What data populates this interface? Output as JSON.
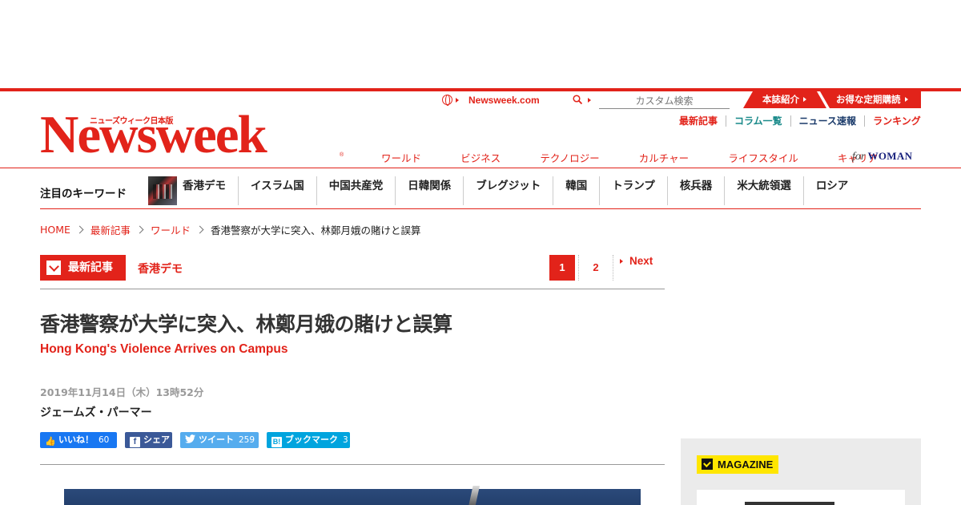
{
  "header": {
    "site_link": "Newsweek.com",
    "search_placeholder": "カスタム検索",
    "tab_about": "本誌紹介",
    "tab_subscribe": "お得な定期購読",
    "sub_links": [
      "最新記事",
      "コラム一覧",
      "ニュース速報",
      "ランキング"
    ],
    "sub_link_colors": [
      "#e2231a",
      "#1a8a8a",
      "#1a3a6a",
      "#e2231a"
    ],
    "logo": "Newsweek",
    "logo_sub": "ニューズウィーク日本版",
    "logo_reg": "®",
    "categories": [
      "ワールド",
      "ビジネス",
      "テクノロジー",
      "カルチャー",
      "ライフスタイル",
      "キャリア"
    ],
    "for_woman_prefix": "for",
    "for_woman": "WOMAN"
  },
  "keywords": {
    "title": "注目のキーワード",
    "items": [
      "香港デモ",
      "イスラム国",
      "中国共産党",
      "日韓関係",
      "ブレグジット",
      "韓国",
      "トランプ",
      "核兵器",
      "米大統領選",
      "ロシア"
    ]
  },
  "breadcrumb": {
    "items": [
      "HOME",
      "最新記事",
      "ワールド"
    ],
    "current": "香港警察が大学に突入、林鄭月娥の賭けと誤算"
  },
  "section": {
    "label": "最新記事",
    "tag": "香港デモ"
  },
  "pagination": {
    "current": "1",
    "next_page": "2",
    "next_label": "Next"
  },
  "article": {
    "title": "香港警察が大学に突入、林鄭月娥の賭けと誤算",
    "subtitle": "Hong Kong's Violence Arrives on Campus",
    "date": "2019年11月14日（木）13時52分",
    "author": "ジェームズ・パーマー"
  },
  "social": {
    "like_label": "いいね！",
    "like_count": "60",
    "share_label": "シェア",
    "tweet_label": "ツイート",
    "tweet_count": "259",
    "hatena_label": "ブックマーク",
    "hatena_count": "3"
  },
  "sidebar": {
    "magazine_label": "MAGAZINE"
  },
  "colors": {
    "brand_red": "#e2231a",
    "magazine_yellow": "#ffe600"
  }
}
